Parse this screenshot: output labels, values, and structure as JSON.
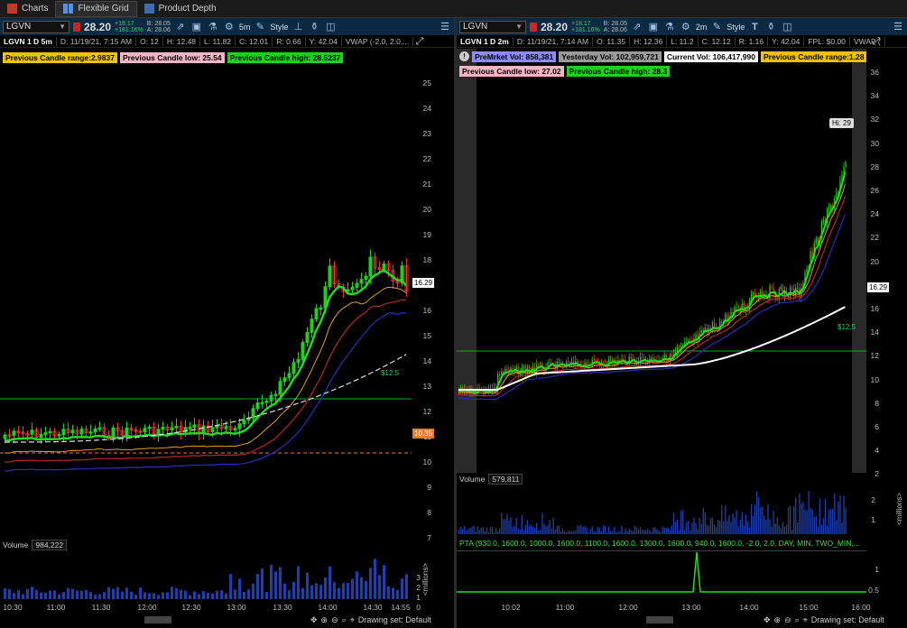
{
  "tabs": [
    {
      "label": "Charts",
      "icon": "charts-icon"
    },
    {
      "label": "Flexible Grid",
      "icon": "grid-icon"
    },
    {
      "label": "Product Depth",
      "icon": "depth-icon"
    }
  ],
  "left": {
    "symbol": "LGVN",
    "price": "28.20",
    "chg_abs": "+18.17",
    "chg_pct": "+181.16%",
    "bid": "B: 28.05",
    "ask": "A: 28.06",
    "style_label": "Style",
    "timeframe": "5m",
    "info": {
      "title": "LGVN 1 D 5m",
      "date": "D: 11/19/21, 7:15 AM",
      "open": "O: 12",
      "high": "H: 12.48",
      "low": "L: 11.82",
      "close": "C: 12.01",
      "range": "R: 0.66",
      "vol": "Y: 42.04",
      "vwap": "VWAP (-2.0, 2.0,..."
    },
    "labels": [
      {
        "text": "Previous Candle range:2.9837",
        "color": "yellow"
      },
      {
        "text": "Previous Candle low: 25.54",
        "color": "pink"
      },
      {
        "text": "Previous Candle high: 28.5237",
        "color": "green"
      }
    ],
    "yticks": [
      "25",
      "24",
      "23",
      "22",
      "21",
      "20",
      "19",
      "18",
      "17",
      "16",
      "15",
      "14",
      "13",
      "12",
      "11",
      "10",
      "9",
      "8",
      "7"
    ],
    "price_tag": "16.29",
    "orange_tag": "10.35",
    "green_level": "$12.5",
    "volume_label": "Volume",
    "volume_value": "984,222",
    "vol_ticks": [
      "3",
      "2",
      "1",
      "0"
    ],
    "vol_unit": "<millions>",
    "xticks": [
      "10:30",
      "11:00",
      "11:30",
      "12:00",
      "12:30",
      "13:00",
      "13:30",
      "14:00",
      "14:30",
      "14:55"
    ],
    "drawing_set": "Drawing set: Default"
  },
  "right": {
    "symbol": "LGVN",
    "price": "28.20",
    "chg_abs": "+18.17",
    "chg_pct": "+181.16%",
    "bid": "B: 28.05",
    "ask": "A: 28.06",
    "style_label": "Style",
    "timeframe": "2m",
    "info": {
      "title": "LGVN 1 D 2m",
      "date": "D: 11/19/21, 7:14 AM",
      "open": "O: 11.35",
      "high": "H: 12.36",
      "low": "L: 11.2",
      "close": "C: 12.12",
      "range": "R: 1.16",
      "vol": "Y: 42.04",
      "fpl": "FPL: $0.00",
      "vwap": "VWAP ("
    },
    "labels_row1": [
      {
        "text": "PreMrket Vol: 858,381",
        "color": "blue"
      },
      {
        "text": "Yesterday Vol: 102,959,721",
        "color": "gray"
      },
      {
        "text": "Current Vol: 106,417,990",
        "color": "white"
      },
      {
        "text": "Previous Candle range:1.28",
        "color": "yellow"
      }
    ],
    "labels_row2": [
      {
        "text": "Previous Candle low: 27.02",
        "color": "pink"
      },
      {
        "text": "Previous Candle high: 28.3",
        "color": "green"
      }
    ],
    "hi_label": "Hi: 29",
    "yticks": [
      "36",
      "34",
      "32",
      "30",
      "28",
      "26",
      "24",
      "22",
      "20",
      "18",
      "16",
      "14",
      "12",
      "10",
      "8",
      "6",
      "4",
      "2"
    ],
    "price_tag": "16.29",
    "green_level": "$12.5",
    "volume_label": "Volume",
    "volume_value": "579,811",
    "vol_ticks": [
      "2",
      "1"
    ],
    "vol_unit": "<millions>",
    "pta_label": "PTA (930.0, 1600.0, 1000.0, 1600.0, 1100.0, 1600.0, 1300.0, 1600.0, 940.0, 1600.0, -2.0, 2.0, DAY, MIN, TWO_MIN,...",
    "pta_ticks": [
      "1",
      "0.5"
    ],
    "xticks": [
      "10:02",
      "11:00",
      "12:00",
      "13:00",
      "14:00",
      "15:00",
      "16:00"
    ],
    "drawing_set": "Drawing set: Default"
  }
}
